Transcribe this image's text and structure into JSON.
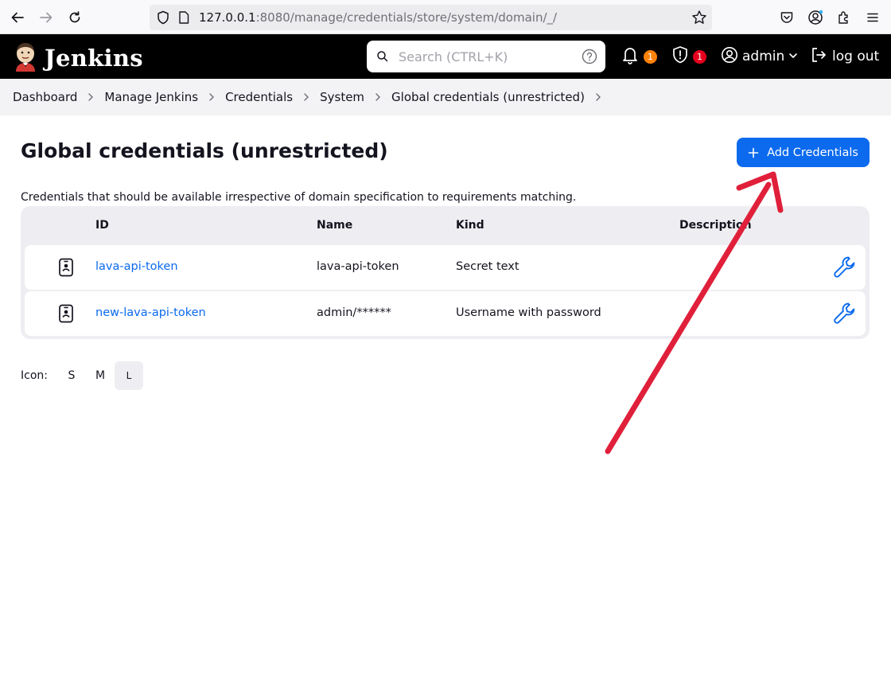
{
  "browser": {
    "url_host": "127.0.0.1",
    "url_rest": ":8080/manage/credentials/store/system/domain/_/"
  },
  "header": {
    "brand": "Jenkins",
    "search_placeholder": "Search (CTRL+K)",
    "notifications_count": "1",
    "security_count": "1",
    "user": "admin",
    "logout": "log out"
  },
  "breadcrumb": [
    "Dashboard",
    "Manage Jenkins",
    "Credentials",
    "System",
    "Global credentials (unrestricted)"
  ],
  "main": {
    "title": "Global credentials (unrestricted)",
    "add_button": "Add Credentials",
    "description": "Credentials that should be available irrespective of domain specification to requirements matching.",
    "columns": [
      "ID",
      "Name",
      "Kind",
      "Description"
    ],
    "rows": [
      {
        "id": "lava-api-token",
        "name": "lava-api-token",
        "kind": "Secret text",
        "description": ""
      },
      {
        "id": "new-lava-api-token",
        "name": "admin/******",
        "kind": "Username with password",
        "description": ""
      }
    ],
    "icon_size": {
      "label": "Icon:",
      "options": [
        "S",
        "M",
        "L"
      ],
      "selected": "L"
    }
  },
  "colors": {
    "accent": "#0b6aee",
    "header_bg": "#000000",
    "annotation_arrow": "#e0203a",
    "badge_orange": "#fe820a",
    "badge_red": "#e6001e"
  }
}
